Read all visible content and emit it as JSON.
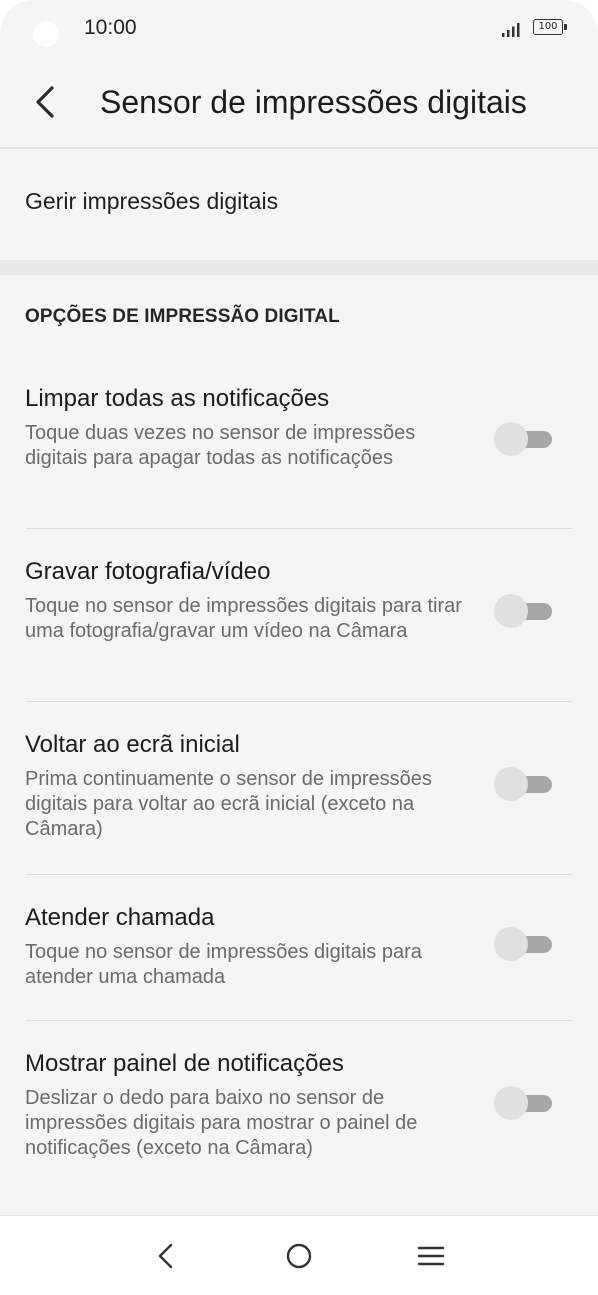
{
  "status_bar": {
    "time": "10:00",
    "battery": "100"
  },
  "header": {
    "back_icon": "chevron-left-icon",
    "title": "Sensor de impressões digitais"
  },
  "manage": {
    "label": "Gerir impressões digitais"
  },
  "section": {
    "header": "OPÇÕES DE IMPRESSÃO DIGITAL"
  },
  "options": [
    {
      "title": "Limpar todas as notificações",
      "description": "Toque duas vezes no sensor de impressões digitais para apagar todas as notificações",
      "enabled": false
    },
    {
      "title": "Gravar fotografia/vídeo",
      "description": "Toque no sensor de impressões digitais para tirar uma fotografia/gravar um vídeo na Câmara",
      "enabled": false
    },
    {
      "title": "Voltar ao ecrã inicial",
      "description": "Prima continuamente o sensor de impressões digitais para voltar ao ecrã inicial (exceto na Câmara)",
      "enabled": false
    },
    {
      "title": "Atender chamada",
      "description": "Toque no sensor de impressões digitais para atender uma chamada",
      "enabled": false
    },
    {
      "title": "Mostrar painel de notificações",
      "description": "Deslizar o dedo para baixo no sensor de impressões digitais para mostrar o painel de notificações (exceto na Câmara)",
      "enabled": false
    }
  ],
  "nav_bar": {
    "back_icon": "nav-back-icon",
    "home_icon": "nav-home-icon",
    "menu_icon": "nav-menu-icon"
  },
  "colors": {
    "background": "#f5f5f5",
    "toggle_track_off": "#a7a7a7",
    "toggle_knob_off": "#e0e0e0",
    "secondary_text": "#6b6b6b"
  }
}
